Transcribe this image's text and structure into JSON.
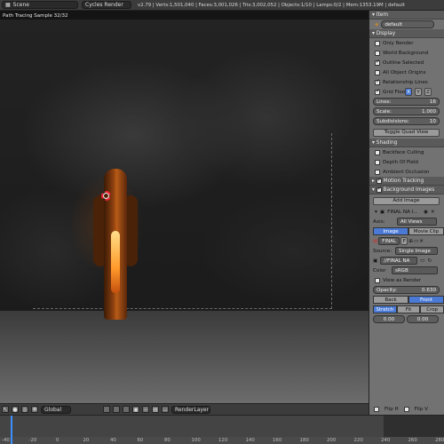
{
  "header": {
    "scene": "Scene",
    "engine": "Cycles Render",
    "stats": "v2.79 | Verts:1,501,040 | Faces:3,001,026 | Tris:3,002,052 | Objects:1/10 | Lamps:0/2 | Mem:1353.19M | default"
  },
  "viewport": {
    "info": "Path Tracing Sample 32/32"
  },
  "panel": {
    "item": {
      "title": "Item",
      "name": "default"
    },
    "display": {
      "title": "Display",
      "options": [
        {
          "label": "Only Render",
          "checked": false
        },
        {
          "label": "World Background",
          "checked": false
        },
        {
          "label": "Outline Selected",
          "checked": true
        },
        {
          "label": "All Object Origins",
          "checked": false
        },
        {
          "label": "Relationship Lines",
          "checked": true
        }
      ],
      "grid_floor": "Grid Floor",
      "axes": [
        "X",
        "Y",
        "Z"
      ],
      "lines_label": "Lines:",
      "lines": "16",
      "scale_label": "Scale:",
      "scale": "1.000",
      "subdiv_label": "Subdivisions:",
      "subdiv": "10",
      "quad": "Toggle Quad View"
    },
    "shading": {
      "title": "Shading",
      "options": [
        {
          "label": "Backface Culling",
          "checked": false
        },
        {
          "label": "Depth Of Field",
          "checked": false
        },
        {
          "label": "Ambient Occlusion",
          "checked": false
        }
      ]
    },
    "motion": "Motion Tracking",
    "bg": {
      "title": "Background Images",
      "add": "Add Image",
      "item": "FINAL NA I...",
      "axis_label": "Axis:",
      "axis": "All Views",
      "tab_image": "Image",
      "tab_clip": "Movie Clip",
      "file": "FINAL",
      "file_f": "F",
      "source_label": "Source:",
      "source": "Single Image",
      "path": "//FINAL NA",
      "color_label": "Color",
      "color": "sRGB",
      "view_render": "View as Render",
      "opacity_label": "Opacity:",
      "opacity": "0.630",
      "back": "Back",
      "front": "Front",
      "stretch": "Stretch",
      "fit": "Fit",
      "crop": "Crop",
      "x": "0.00",
      "y": "0.00",
      "fliph": "Flip H",
      "flipv": "Flip V"
    }
  },
  "footer": {
    "orientation": "Global",
    "layer": "RenderLayer"
  },
  "timeline": {
    "ticks": [
      "-40",
      "-20",
      "0",
      "20",
      "40",
      "60",
      "80",
      "100",
      "120",
      "140",
      "160",
      "180",
      "200",
      "220",
      "240",
      "260",
      "280"
    ]
  }
}
